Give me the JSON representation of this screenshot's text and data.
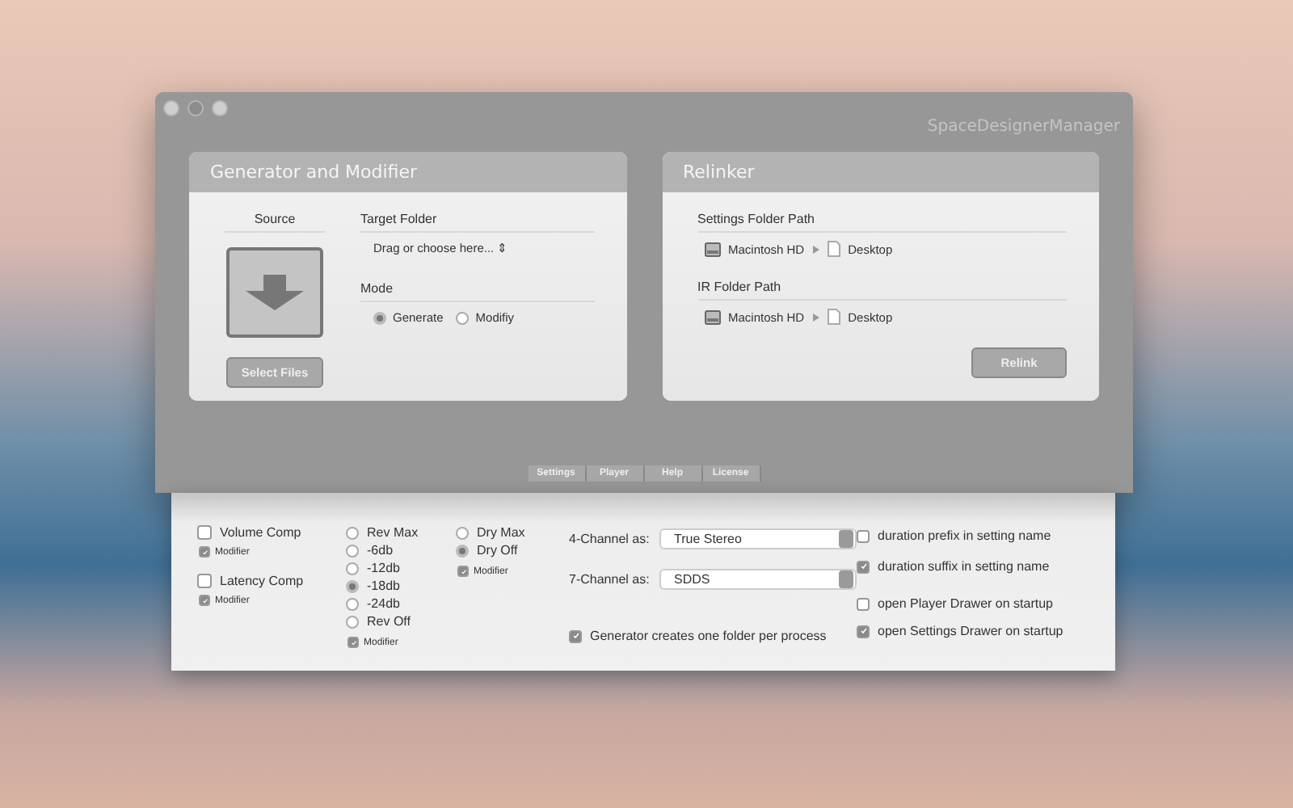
{
  "window": {
    "title": "SpaceDesignerManager"
  },
  "generator": {
    "title": "Generator and Modifier",
    "source_label": "Source",
    "select_button": "Select Files",
    "target_label": "Target Folder",
    "target_placeholder": "Drag or choose here... ⇕",
    "mode_label": "Mode",
    "modes": [
      {
        "label": "Generate",
        "selected": true
      },
      {
        "label": "Modifiy",
        "selected": false
      }
    ]
  },
  "relinker": {
    "title": "Relinker",
    "paths": [
      {
        "label": "Settings Folder Path",
        "disk": "Macintosh HD",
        "folder": "Desktop"
      },
      {
        "label": "IR Folder Path",
        "disk": "Macintosh HD",
        "folder": "Desktop"
      }
    ],
    "button": "Relink"
  },
  "tabs": [
    {
      "label": "Settings",
      "selected": false
    },
    {
      "label": "Player",
      "selected": false
    },
    {
      "label": "Help",
      "selected": false
    },
    {
      "label": "License",
      "selected": false
    }
  ],
  "drawer": {
    "comps": [
      {
        "label": "Volume Comp",
        "checked": false,
        "modifier": {
          "label": "Modifier",
          "checked": true
        }
      },
      {
        "label": "Latency Comp",
        "checked": false,
        "modifier": {
          "label": "Modifier",
          "checked": true
        }
      }
    ],
    "rev": {
      "options": [
        {
          "label": "Rev Max",
          "selected": false
        },
        {
          "label": "-6db",
          "selected": false
        },
        {
          "label": "-12db",
          "selected": false
        },
        {
          "label": "-18db",
          "selected": true
        },
        {
          "label": "-24db",
          "selected": false
        },
        {
          "label": "Rev Off",
          "selected": false
        }
      ],
      "modifier": {
        "label": "Modifier",
        "checked": true
      }
    },
    "dry": {
      "options": [
        {
          "label": "Dry Max",
          "selected": false
        },
        {
          "label": "Dry Off",
          "selected": true
        }
      ],
      "modifier": {
        "label": "Modifier",
        "checked": true
      }
    },
    "selects": [
      {
        "label": "4-Channel as:",
        "value": "True Stereo"
      },
      {
        "label": "7-Channel as:",
        "value": "SDDS"
      }
    ],
    "folder_option": {
      "label": "Generator creates one folder per process",
      "checked": true
    },
    "name_options": [
      {
        "label": "duration prefix in setting name",
        "checked": false
      },
      {
        "label": "duration suffix in setting name",
        "checked": true
      }
    ],
    "startup_options": [
      {
        "label": "open Player Drawer on startup",
        "checked": false
      },
      {
        "label": "open Settings Drawer on startup",
        "checked": true
      }
    ]
  }
}
